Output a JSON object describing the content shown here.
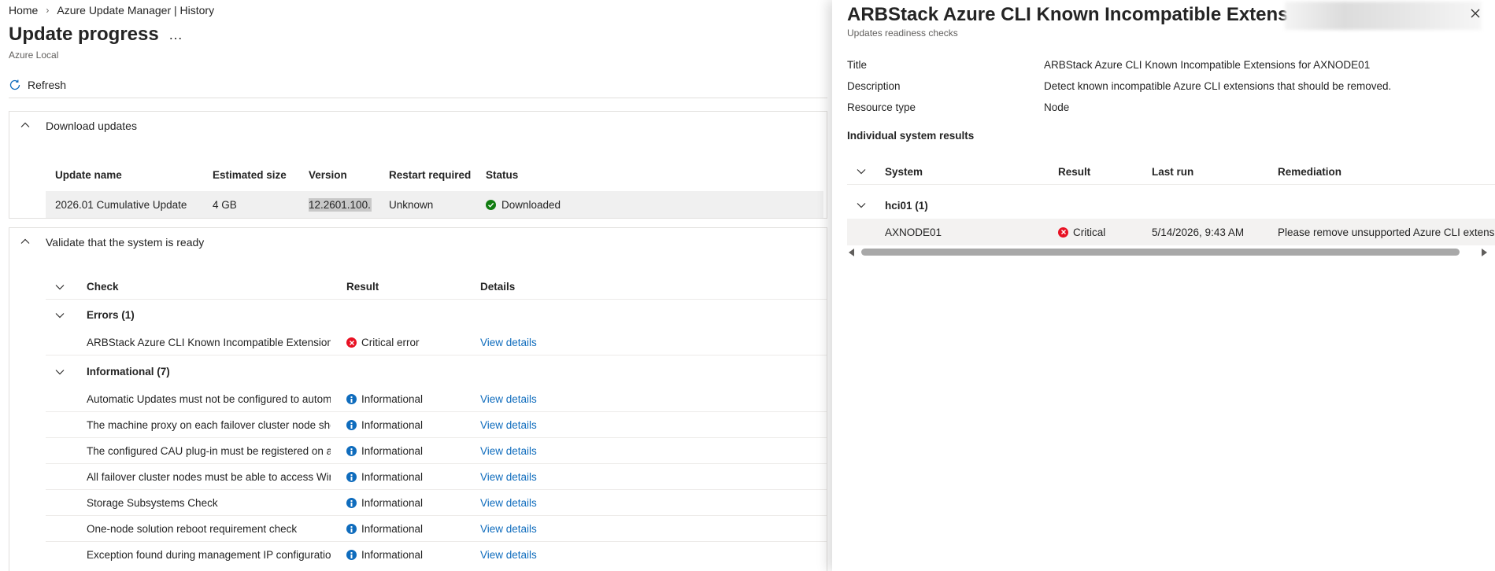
{
  "breadcrumb": {
    "home": "Home",
    "current": "Azure Update Manager | History"
  },
  "page": {
    "title": "Update progress",
    "more": "…",
    "subtitle": "Azure Local"
  },
  "toolbar": {
    "refresh_label": "Refresh"
  },
  "download": {
    "section_label": "Download updates",
    "columns": [
      "Update name",
      "Estimated size",
      "Version",
      "Restart required",
      "Status"
    ],
    "row": {
      "name": "2026.01 Cumulative Update",
      "size": "4 GB",
      "version": "12.2601.100...",
      "restart": "Unknown",
      "status": "Downloaded"
    }
  },
  "validate": {
    "section_label": "Validate that the system is ready",
    "columns": [
      "Check",
      "Result",
      "Details"
    ],
    "errors_group": "Errors (1)",
    "errors": [
      {
        "check": "ARBStack Azure CLI Known Incompatible Extensions fc",
        "result": "Critical error",
        "details": "View details"
      }
    ],
    "info_group": "Informational (7)",
    "informational": [
      {
        "check": "Automatic Updates must not be configured to automa",
        "result": "Informational",
        "details": "View details"
      },
      {
        "check": "The machine proxy on each failover cluster node shou",
        "result": "Informational",
        "details": "View details"
      },
      {
        "check": "The configured CAU plug-in must be registered on all",
        "result": "Informational",
        "details": "View details"
      },
      {
        "check": "All failover cluster nodes must be able to access Wind",
        "result": "Informational",
        "details": "View details"
      },
      {
        "check": "Storage Subsystems Check",
        "result": "Informational",
        "details": "View details"
      },
      {
        "check": "One-node solution reboot requirement check",
        "result": "Informational",
        "details": "View details"
      },
      {
        "check": "Exception found during management IP configuration",
        "result": "Informational",
        "details": "View details"
      }
    ]
  },
  "panel": {
    "title": "ARBStack Azure CLI Known Incompatible Extensions",
    "subtitle": "Updates readiness checks",
    "props": [
      {
        "key": "Title",
        "value": "ARBStack Azure CLI Known Incompatible Extensions for AXNODE01"
      },
      {
        "key": "Description",
        "value": "Detect known incompatible Azure CLI extensions that should be removed."
      },
      {
        "key": "Resource type",
        "value": "Node"
      }
    ],
    "results_heading": "Individual system results",
    "columns": [
      "System",
      "Result",
      "Last run",
      "Remediation"
    ],
    "group": "hci01 (1)",
    "row": {
      "system": "AXNODE01",
      "result": "Critical",
      "last_run": "5/14/2026, 9:43 AM",
      "remediation": "Please remove unsupported Azure CLI extensio"
    }
  },
  "colors": {
    "accent": "#0f6cbd",
    "success": "#107c10",
    "error": "#e81123",
    "info": "#0f6cbd"
  }
}
